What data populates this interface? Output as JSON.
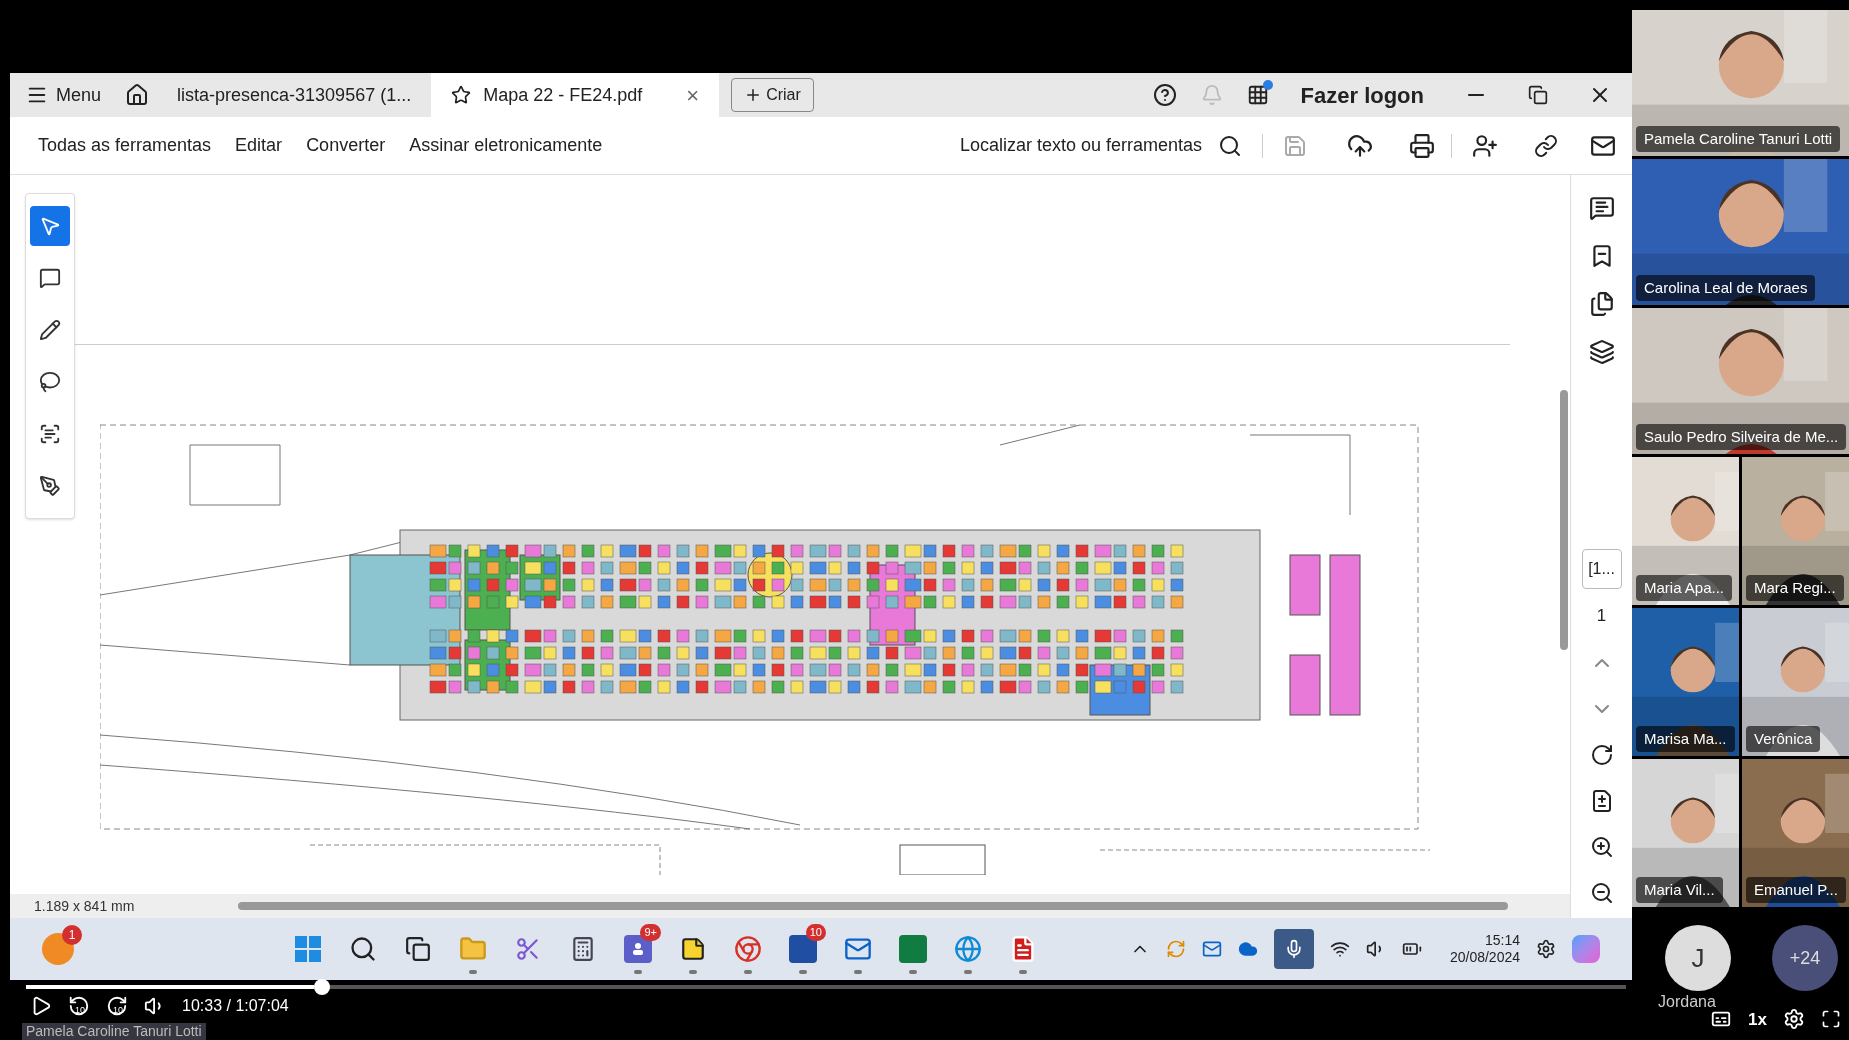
{
  "app": {
    "menu": "Menu",
    "tabs": [
      {
        "label": "lista-presenca-31309567 (1...",
        "selected": false,
        "starred": false,
        "closable": false
      },
      {
        "label": "Mapa 22 - FE24.pdf",
        "selected": true,
        "starred": true,
        "closable": true
      }
    ],
    "create_button": "Criar",
    "close_glyph": "×",
    "sign_in": "Fazer logon",
    "tools_menu": [
      "Todas as ferramentas",
      "Editar",
      "Converter",
      "Assinar eletronicamente"
    ],
    "search_label": "Localizar texto ou ferramentas",
    "palette": [
      {
        "kind": "select",
        "selected": true
      },
      {
        "kind": "comment",
        "selected": false
      },
      {
        "kind": "pen",
        "selected": false
      },
      {
        "kind": "lasso",
        "selected": false
      },
      {
        "kind": "text-select",
        "selected": false
      },
      {
        "kind": "sign",
        "selected": false
      }
    ],
    "page_size": "1.189 x 841 mm",
    "page_box": "[1...",
    "page_number": "1"
  },
  "taskbar": {
    "notification_badge": "1",
    "apps": [
      {
        "kind": "start",
        "running": false
      },
      {
        "kind": "search",
        "running": false
      },
      {
        "kind": "taskview",
        "running": false
      },
      {
        "kind": "folder",
        "running": true
      },
      {
        "kind": "snip",
        "running": false
      },
      {
        "kind": "calculator",
        "running": false
      },
      {
        "kind": "teams",
        "running": true,
        "badge": "9+"
      },
      {
        "kind": "notes",
        "running": true
      },
      {
        "kind": "chrome",
        "running": true
      },
      {
        "kind": "whiteboard",
        "running": true,
        "badge": "10"
      },
      {
        "kind": "outlook",
        "running": true
      },
      {
        "kind": "excel",
        "running": true
      },
      {
        "kind": "edge",
        "running": true
      },
      {
        "kind": "acrobat",
        "running": true
      }
    ],
    "time": "15:14",
    "date": "20/08/2024"
  },
  "player": {
    "level": 0.18,
    "skip_back": "10",
    "skip_forward": "10",
    "time": "10:33 / 1:07:04",
    "presenter": "Pamela Caroline Tanuri Lotti",
    "speed": "1x"
  },
  "participants": [
    {
      "name": "Pamela Caroline Tanuri Lotti",
      "kind": "large"
    },
    {
      "name": "Carolina Leal de Moraes",
      "kind": "large"
    },
    {
      "name": "Saulo Pedro Silveira de Me...",
      "kind": "large"
    },
    {
      "name": "Maria Apa...",
      "kind": "small"
    },
    {
      "name": "Mara Regi...",
      "kind": "small"
    },
    {
      "name": "Marisa Ma...",
      "kind": "small"
    },
    {
      "name": "Verônica",
      "kind": "small"
    },
    {
      "name": "Maria Vil...",
      "kind": "small"
    },
    {
      "name": "Emanuel P...",
      "kind": "small"
    }
  ],
  "waiting": {
    "initial": "J",
    "name": "Jordana",
    "more": "+24"
  }
}
